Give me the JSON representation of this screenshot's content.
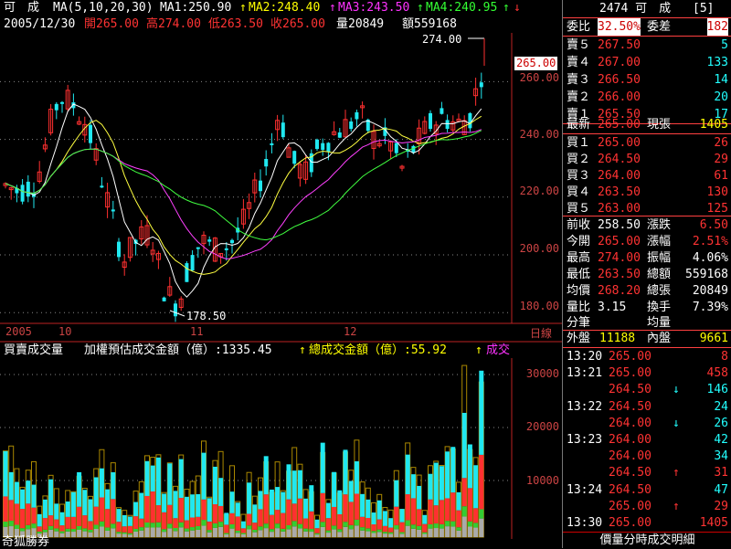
{
  "header": {
    "stock_name": "可　成",
    "ma_params": "MA(5,10,20,30)",
    "ma1_label": "MA1:250.90",
    "ma2_label": "MA2:248.40",
    "ma3_label": "MA3:243.50",
    "ma4_label": "MA4:240.95",
    "date": "2005/12/30",
    "open": "開265.00",
    "high": "高274.00",
    "low": "低263.50",
    "close": "收265.00",
    "volume": "量20849",
    "amount": "額559168",
    "up_arrow": "↑",
    "down_arrow": "↓"
  },
  "price_chart": {
    "y_ticks": [
      "260.00",
      "240.00",
      "220.00",
      "200.00",
      "180.00"
    ],
    "current_price": "265.00",
    "high_label": "274.00",
    "low_label": "178.50",
    "x_labels": [
      "2005",
      "10",
      "11",
      "12"
    ],
    "period_label": "日線"
  },
  "volume_chart": {
    "title": "買賣成交量",
    "weighted": "加權預估成交金額（億）:1335.45",
    "total": "總成交金額（億）:55.92",
    "extra": "成交",
    "y_ticks": [
      "30000",
      "20000",
      "10000"
    ],
    "broker": "奇狐勝券"
  },
  "colors": {
    "up": "#ff3030",
    "down": "#20e8f0",
    "ma1": "#ffffff",
    "ma2": "#ffff40",
    "ma3": "#ff40ff",
    "ma4": "#40ff40"
  },
  "side": {
    "code_name": "2474 可　成",
    "page": "[5]",
    "weibi_label": "委比",
    "weibi": "32.50%",
    "weicha_label": "委差",
    "weicha": "182",
    "asks": [
      {
        "label": "賣５",
        "price": "267.50",
        "qty": "5"
      },
      {
        "label": "賣４",
        "price": "267.00",
        "qty": "133"
      },
      {
        "label": "賣３",
        "price": "266.50",
        "qty": "14"
      },
      {
        "label": "賣２",
        "price": "266.00",
        "qty": "20"
      },
      {
        "label": "賣１",
        "price": "265.50",
        "qty": "17"
      }
    ],
    "latest_label": "最新",
    "latest": "265.00",
    "cur_vol_label": "現張",
    "cur_vol": "1405",
    "bids": [
      {
        "label": "買１",
        "price": "265.00",
        "qty": "26"
      },
      {
        "label": "買２",
        "price": "264.50",
        "qty": "29"
      },
      {
        "label": "買３",
        "price": "264.00",
        "qty": "61"
      },
      {
        "label": "買４",
        "price": "263.50",
        "qty": "130"
      },
      {
        "label": "買５",
        "price": "263.00",
        "qty": "125"
      }
    ],
    "stats": [
      {
        "l1": "前收",
        "v1": "258.50",
        "l2": "漲跌",
        "v2": "6.50"
      },
      {
        "l1": "今開",
        "v1": "265.00",
        "l2": "漲幅",
        "v2": "2.51%"
      },
      {
        "l1": "最高",
        "v1": "274.00",
        "l2": "振幅",
        "v2": "4.06%"
      },
      {
        "l1": "最低",
        "v1": "263.50",
        "l2": "總額",
        "v2": "559168"
      },
      {
        "l1": "均價",
        "v1": "268.20",
        "l2": "總張",
        "v2": "20849"
      },
      {
        "l1": "量比",
        "v1": "3.15",
        "l2": "換手",
        "v2": "7.39%"
      }
    ],
    "fenbi": "分筆",
    "junliang": "均量",
    "outer_label": "外盤",
    "outer": "11188",
    "inner_label": "內盤",
    "inner": "9661",
    "ticks": [
      {
        "time": "13:20",
        "price": "265.00",
        "arrow": "",
        "qty": "8"
      },
      {
        "time": "13:21",
        "price": "265.00",
        "arrow": "",
        "qty": "458"
      },
      {
        "time": "",
        "price": "264.50",
        "arrow": "↓",
        "qty": "146"
      },
      {
        "time": "13:22",
        "price": "264.50",
        "arrow": "",
        "qty": "24"
      },
      {
        "time": "",
        "price": "264.00",
        "arrow": "↓",
        "qty": "26"
      },
      {
        "time": "13:23",
        "price": "264.00",
        "arrow": "",
        "qty": "42"
      },
      {
        "time": "",
        "price": "264.00",
        "arrow": "",
        "qty": "34"
      },
      {
        "time": "",
        "price": "264.50",
        "arrow": "↑",
        "qty": "31"
      },
      {
        "time": "13:24",
        "price": "264.50",
        "arrow": "",
        "qty": "47"
      },
      {
        "time": "",
        "price": "265.00",
        "arrow": "↑",
        "qty": "29"
      },
      {
        "time": "13:30",
        "price": "265.00",
        "arrow": "",
        "qty": "1405"
      }
    ],
    "footer": "價量分時成交明細"
  }
}
